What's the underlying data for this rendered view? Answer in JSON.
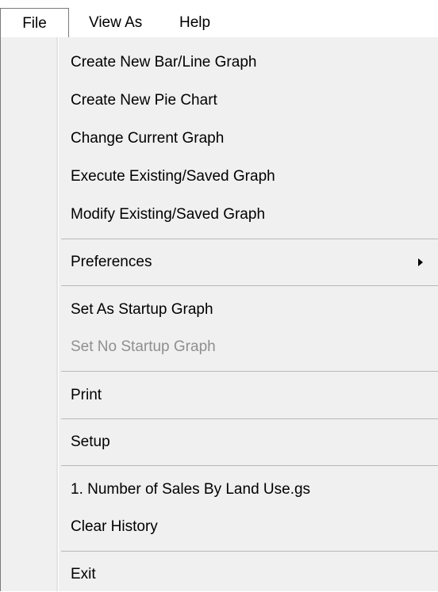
{
  "menubar": {
    "file": "File",
    "view_as": "View As",
    "help": "Help"
  },
  "file_menu": {
    "items": [
      {
        "label": "Create New Bar/Line Graph",
        "enabled": true
      },
      {
        "label": "Create New Pie Chart",
        "enabled": true
      },
      {
        "label": "Change Current Graph",
        "enabled": true
      },
      {
        "label": "Execute Existing/Saved Graph",
        "enabled": true
      },
      {
        "label": "Modify Existing/Saved Graph",
        "enabled": true
      },
      {
        "label": "Preferences",
        "enabled": true,
        "has_submenu": true
      },
      {
        "label": "Set As Startup Graph",
        "enabled": true
      },
      {
        "label": "Set No Startup Graph",
        "enabled": false
      },
      {
        "label": "Print",
        "enabled": true
      },
      {
        "label": "Setup",
        "enabled": true
      },
      {
        "label": "1. Number of Sales By Land Use.gs",
        "enabled": true
      },
      {
        "label": "Clear History",
        "enabled": true
      },
      {
        "label": "Exit",
        "enabled": true
      }
    ]
  }
}
